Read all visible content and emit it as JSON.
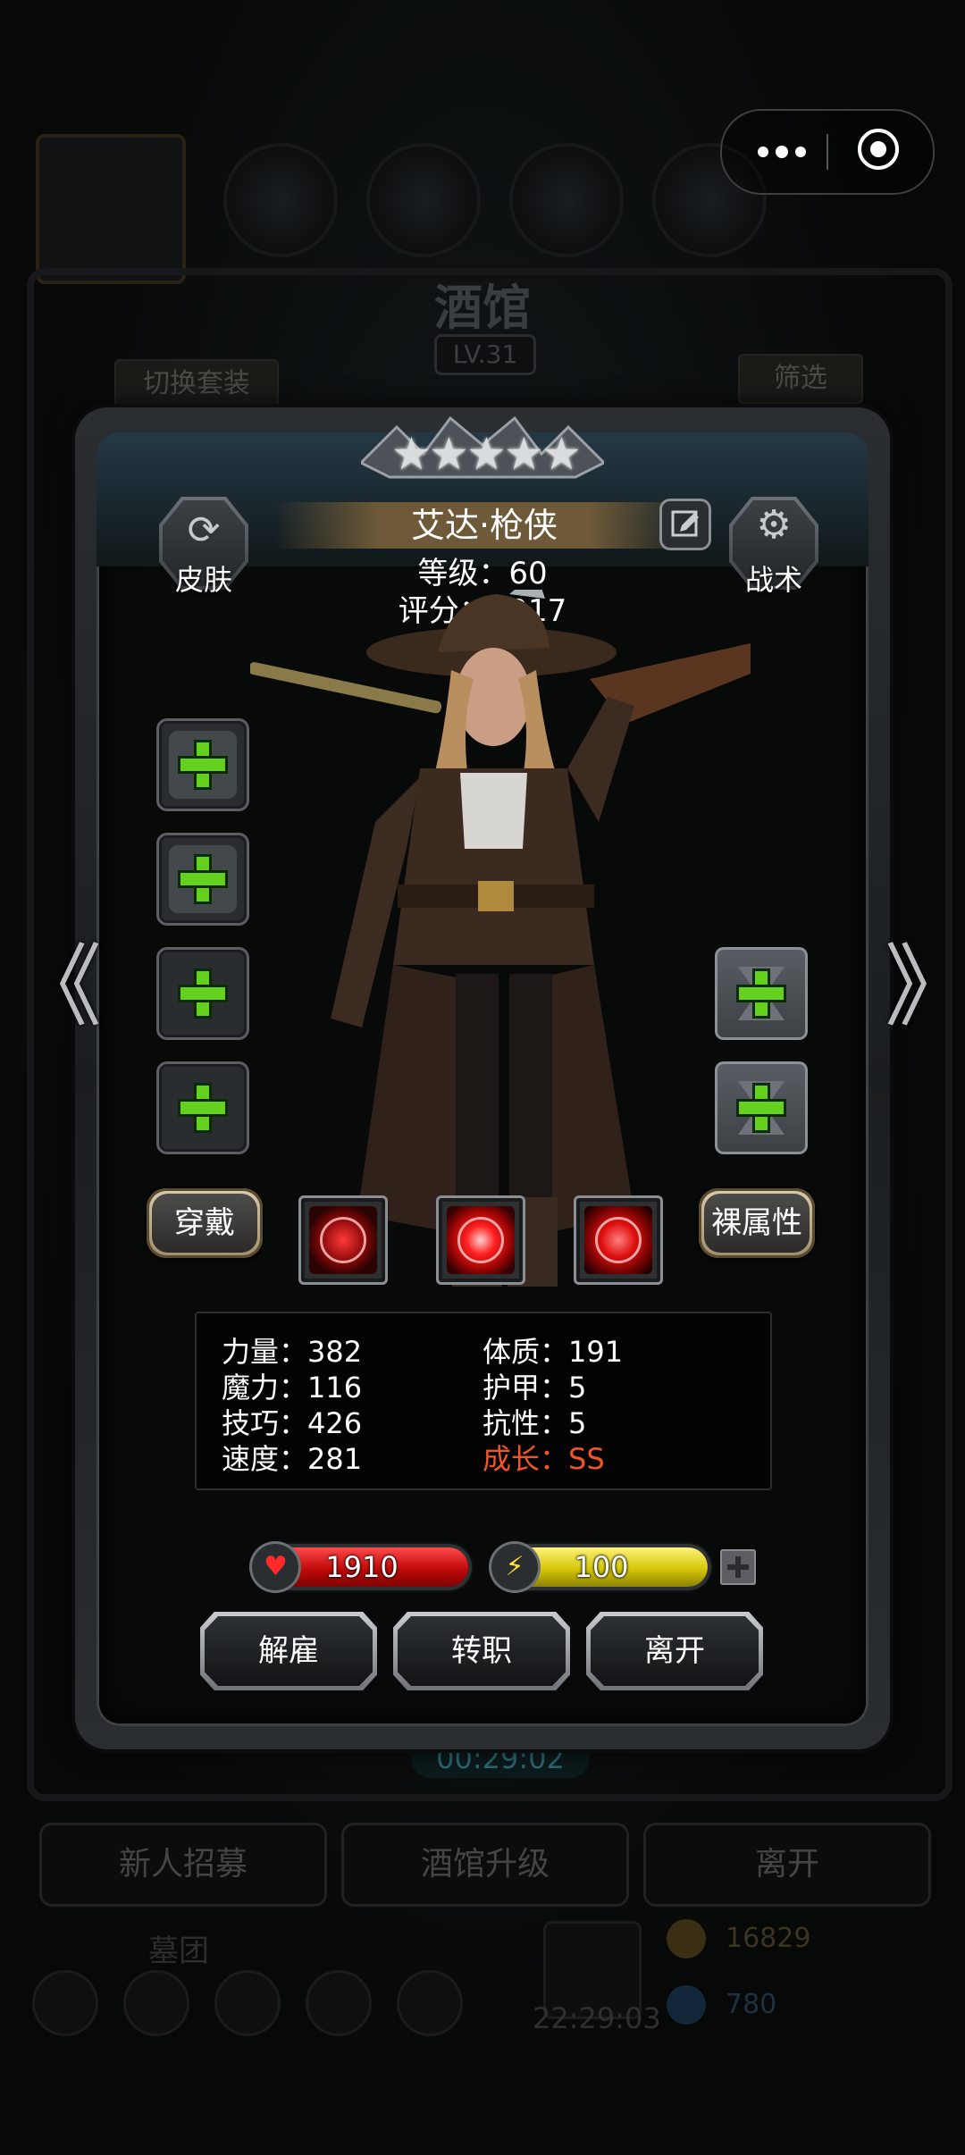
{
  "background": {
    "title": "酒馆",
    "level": "LV.31",
    "switch_outfit_label": "切换套装",
    "filter_label": "筛选",
    "timer": "00:29:02",
    "bottom_buttons": [
      "新人招募",
      "酒馆升级",
      "离开"
    ],
    "guild_label": "墓团",
    "clock": "22:29:03",
    "gold": "16829",
    "gems": "780"
  },
  "modal": {
    "stars": 5,
    "hero_name": "艾达·枪侠",
    "level_line": "等级：60",
    "score_line": "评分：1917",
    "skin_label": "皮肤",
    "tactics_label": "战术",
    "wear_label": "穿戴",
    "bare_attr_label": "裸属性",
    "stats": {
      "strength": "力量：382",
      "magic": "魔力：116",
      "skill": "技巧：426",
      "speed": "速度：281",
      "constitution": "体质：191",
      "armor": "护甲：5",
      "resistance": "抗性：5",
      "growth": "成长：SS"
    },
    "hp": "1910",
    "mp": "100",
    "buttons": {
      "dismiss": "解雇",
      "job_change": "转职",
      "leave": "离开"
    },
    "nav": {
      "prev": "《",
      "next": "》"
    }
  },
  "colors": {
    "growth": "#f2542a",
    "plus_green": "#63d11e",
    "hp_red": "#c00909",
    "mp_yellow": "#d6c709"
  }
}
